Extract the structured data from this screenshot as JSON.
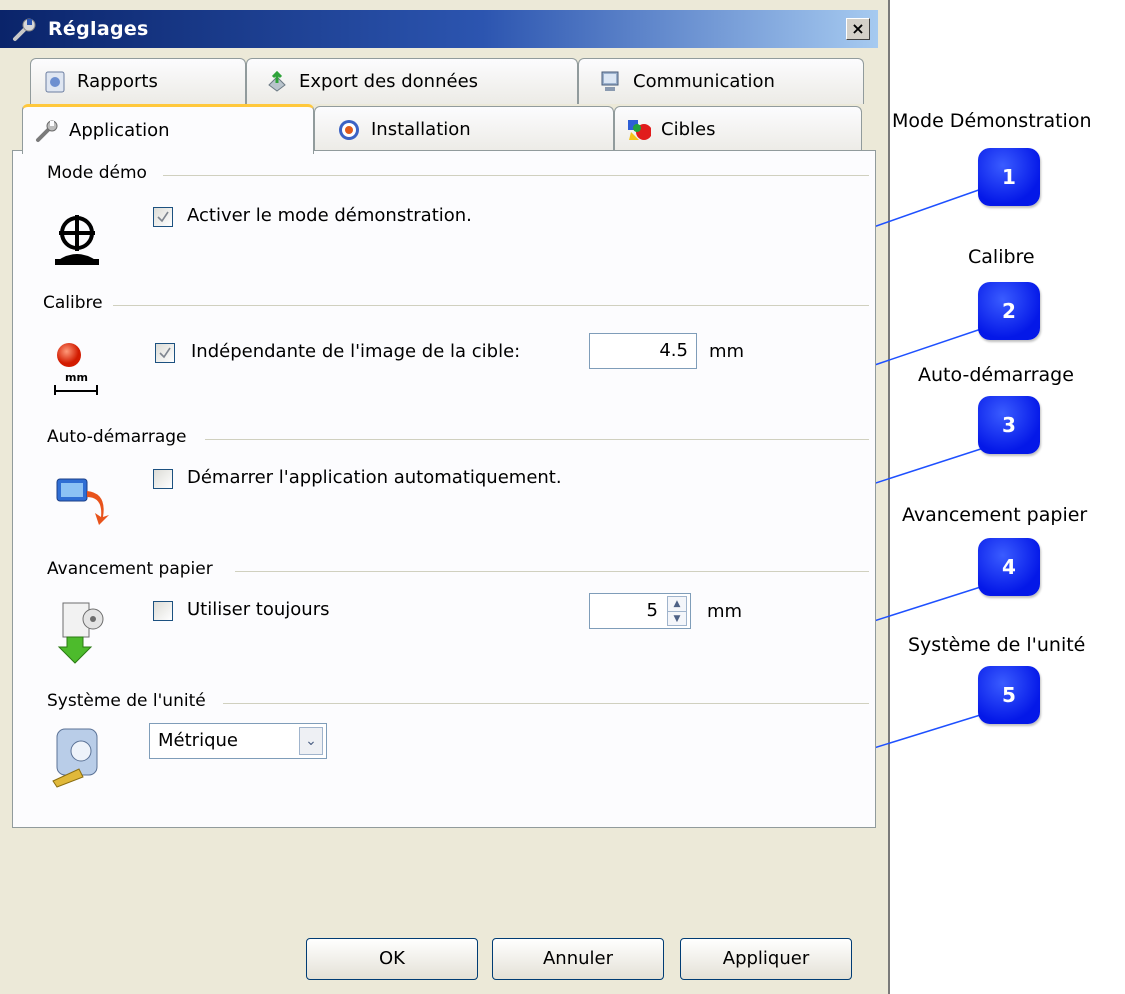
{
  "window": {
    "title": "Réglages",
    "close_label": "×"
  },
  "tabs_row1": [
    {
      "label": "Rapports"
    },
    {
      "label": "Export des données"
    },
    {
      "label": "Communication"
    }
  ],
  "tabs_row2": [
    {
      "label": "Application",
      "active": true
    },
    {
      "label": "Installation"
    },
    {
      "label": "Cibles"
    }
  ],
  "groups": {
    "demo": {
      "title": "Mode démo",
      "checkbox_label": "Activer le mode démonstration.",
      "checked": true
    },
    "calibre": {
      "title": "Calibre",
      "checkbox_label": "Indépendante de l'image de la cible:",
      "checked": true,
      "value": "4.5",
      "unit": "mm",
      "icon_text": "mm"
    },
    "autostart": {
      "title": "Auto-démarrage",
      "checkbox_label": "Démarrer l'application automatiquement.",
      "checked": false
    },
    "paper": {
      "title": "Avancement papier",
      "checkbox_label": "Utiliser toujours",
      "checked": false,
      "value": "5",
      "unit": "mm"
    },
    "units": {
      "title": "Système de l'unité",
      "selected": "Métrique"
    }
  },
  "buttons": {
    "ok": "OK",
    "cancel": "Annuler",
    "apply": "Appliquer"
  },
  "annotations": [
    {
      "number": "1",
      "title": "Mode Démonstration"
    },
    {
      "number": "2",
      "title": "Calibre"
    },
    {
      "number": "3",
      "title": "Auto-démarrage"
    },
    {
      "number": "4",
      "title": "Avancement papier"
    },
    {
      "number": "5",
      "title": "Système de l'unité"
    }
  ],
  "colors": {
    "accent_blue": "#0418e8",
    "title_bar": "#0a246a",
    "tab_highlight": "#ffc83c"
  }
}
